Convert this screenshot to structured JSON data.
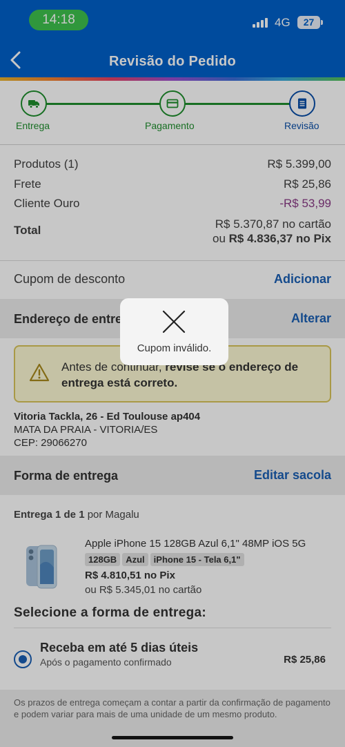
{
  "status": {
    "time": "14:18",
    "network": "4G",
    "battery": "27"
  },
  "header": {
    "title": "Revisão do Pedido"
  },
  "steps": [
    {
      "label": "Entrega",
      "icon": "truck-icon",
      "state": "done"
    },
    {
      "label": "Pagamento",
      "icon": "card-icon",
      "state": "done"
    },
    {
      "label": "Revisão",
      "icon": "document-icon",
      "state": "active"
    }
  ],
  "summary": {
    "products_label": "Produtos (1)",
    "products_value": "R$ 5.399,00",
    "shipping_label": "Frete",
    "shipping_value": "R$ 25,86",
    "member_label": "Cliente Ouro",
    "member_value": "-R$ 53,99",
    "total_label": "Total",
    "total_card": "R$ 5.370,87 no cartão",
    "total_pix_prefix": "ou ",
    "total_pix": "R$ 4.836,37 no Pix"
  },
  "coupon": {
    "label": "Cupom de desconto",
    "action": "Adicionar"
  },
  "address_section": {
    "title": "Endereço de entrega",
    "action": "Alterar",
    "warning_prefix": "Antes de continuar, ",
    "warning_bold": "revise se o endereço de entrega está correto.",
    "line1": "Vitoria Tackla, 26 - Ed Toulouse ap404",
    "line2": "MATA DA PRAIA - VITORIA/ES",
    "line3": "CEP: 29066270"
  },
  "delivery_section": {
    "title": "Forma de entrega",
    "action": "Editar sacola",
    "delivery_of": "Entrega 1 de 1",
    "seller": " por Magalu"
  },
  "product": {
    "name": "Apple iPhone 15 128GB Azul 6,1\" 48MP iOS 5G",
    "tags": [
      "128GB",
      "Azul",
      "iPhone 15 - Tela 6,1\""
    ],
    "price_pix": "R$ 4.810,51 no Pix",
    "price_card": "ou R$ 5.345,01 no cartão"
  },
  "shipping_options": {
    "title": "Selecione a forma de entrega:",
    "option_title": "Receba em até 5 dias úteis",
    "option_sub": "Após o pagamento confirmado",
    "option_price": "R$ 25,86"
  },
  "footer_note": "Os prazos de entrega começam a contar a partir da confirmação de pagamento e podem variar para mais de uma unidade de um mesmo produto.",
  "toast": {
    "message": "Cupom inválido.",
    "icon": "close-icon"
  },
  "colors": {
    "brand": "#0060c9",
    "success": "#1f8f2e",
    "link": "#1a5fb4",
    "discount": "#8a3a86"
  }
}
